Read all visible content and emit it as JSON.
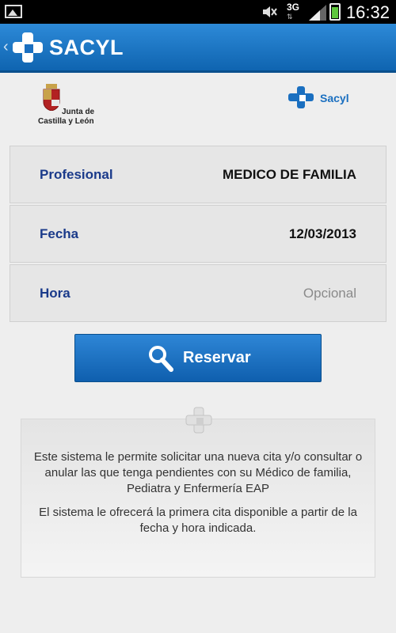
{
  "status_bar": {
    "time": "16:32",
    "network": "3G",
    "icons": [
      "picture-icon",
      "mute-icon",
      "signal-icon",
      "battery-icon"
    ]
  },
  "app_bar": {
    "title": "SACYL",
    "back_glyph": "‹",
    "logo_icon": "sacyl-cross-icon"
  },
  "logos": {
    "jcyl_line1": "Junta de",
    "jcyl_line2": "Castilla y León",
    "sacyl_text": "Sacyl"
  },
  "form": {
    "rows": [
      {
        "label": "Profesional",
        "value": "MEDICO DE FAMILIA"
      },
      {
        "label": "Fecha",
        "value": "12/03/2013"
      },
      {
        "label": "Hora",
        "value": "Opcional"
      }
    ]
  },
  "reserve_button": {
    "label": "Reservar",
    "icon": "search-icon"
  },
  "info": {
    "paragraph1": "Este sistema le permite solicitar una nueva cita y/o consultar o anular las que tenga pendientes con su Médico de familia, Pediatra y Enfermería EAP",
    "paragraph2": "El sistema le ofrecerá la primera cita disponible a partir de la fecha y hora indicada."
  },
  "colors": {
    "accent": "#1565c0",
    "label_blue": "#1a3a8a",
    "placeholder_gray": "#8a8a8a"
  }
}
